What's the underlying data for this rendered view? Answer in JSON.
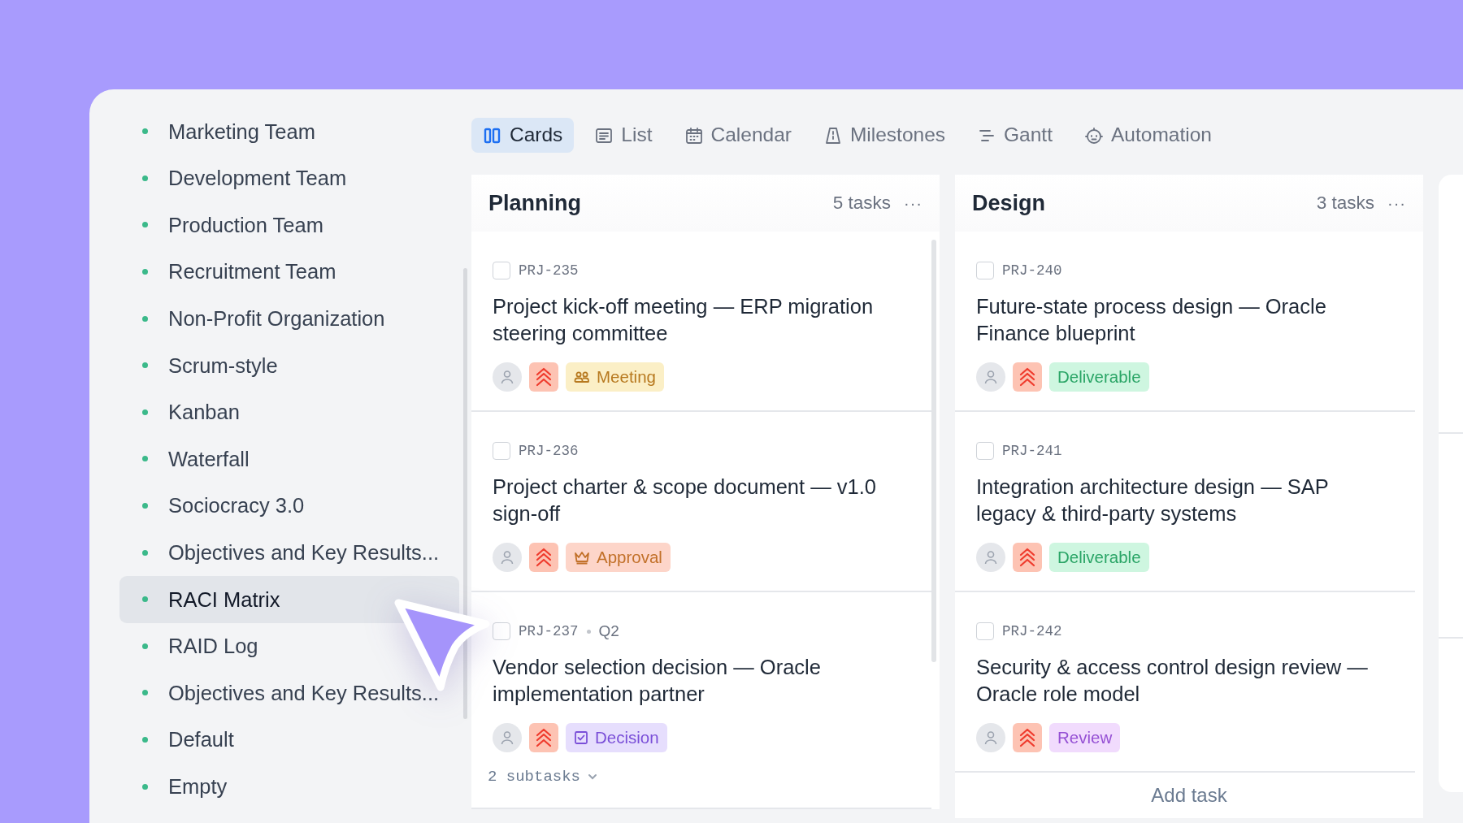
{
  "sidebar": {
    "items": [
      {
        "label": "Marketing Team",
        "selected": false
      },
      {
        "label": "Development Team",
        "selected": false
      },
      {
        "label": "Production Team",
        "selected": false
      },
      {
        "label": "Recruitment Team",
        "selected": false
      },
      {
        "label": "Non-Profit Organization",
        "selected": false
      },
      {
        "label": "Scrum-style",
        "selected": false
      },
      {
        "label": "Kanban",
        "selected": false
      },
      {
        "label": "Waterfall",
        "selected": false
      },
      {
        "label": "Sociocracy 3.0",
        "selected": false
      },
      {
        "label": "Objectives and Key Results...",
        "selected": false
      },
      {
        "label": "RACI Matrix",
        "selected": true
      },
      {
        "label": "RAID Log",
        "selected": false
      },
      {
        "label": "Objectives and Key Results...",
        "selected": false
      },
      {
        "label": "Default",
        "selected": false
      },
      {
        "label": "Empty",
        "selected": false
      }
    ]
  },
  "tabs": [
    {
      "label": "Cards",
      "kind": "cards",
      "selected": true
    },
    {
      "label": "List",
      "kind": "list",
      "selected": false
    },
    {
      "label": "Calendar",
      "kind": "calendar",
      "selected": false
    },
    {
      "label": "Milestones",
      "kind": "milestones",
      "selected": false
    },
    {
      "label": "Gantt",
      "kind": "gantt",
      "selected": false
    },
    {
      "label": "Automation",
      "kind": "automation",
      "selected": false
    }
  ],
  "columns": [
    {
      "title": "Planning",
      "count": "5 tasks",
      "more": "···",
      "cards": [
        {
          "id": "PRJ-235",
          "checked": false,
          "title": "Project kick-off meeting — ERP migration steering committee",
          "tag": {
            "label": "Meeting",
            "kind": "meeting"
          }
        },
        {
          "id": "PRJ-236",
          "checked": false,
          "title": "Project charter & scope document — v1.0 sign-off",
          "tag": {
            "label": "Approval",
            "kind": "approval"
          }
        },
        {
          "id": "PRJ-237",
          "meta": "Q2",
          "checked": false,
          "title": "Vendor selection decision — Oracle implementation partner",
          "tag": {
            "label": "Decision",
            "kind": "decision"
          },
          "subtasks": "2 subtasks"
        }
      ]
    },
    {
      "title": "Design",
      "count": "3 tasks",
      "more": "···",
      "cards": [
        {
          "id": "PRJ-240",
          "checked": false,
          "title": "Future-state process design — Oracle Finance blueprint",
          "tag": {
            "label": "Deliverable",
            "kind": "deliverable"
          }
        },
        {
          "id": "PRJ-241",
          "checked": false,
          "title": "Integration architecture design — SAP legacy & third-party systems",
          "tag": {
            "label": "Deliverable",
            "kind": "deliverable"
          }
        },
        {
          "id": "PRJ-242",
          "checked": false,
          "title": "Security & access control design review — Oracle role model",
          "tag": {
            "label": "Review",
            "kind": "review"
          }
        }
      ],
      "add_task": "Add task"
    }
  ]
}
